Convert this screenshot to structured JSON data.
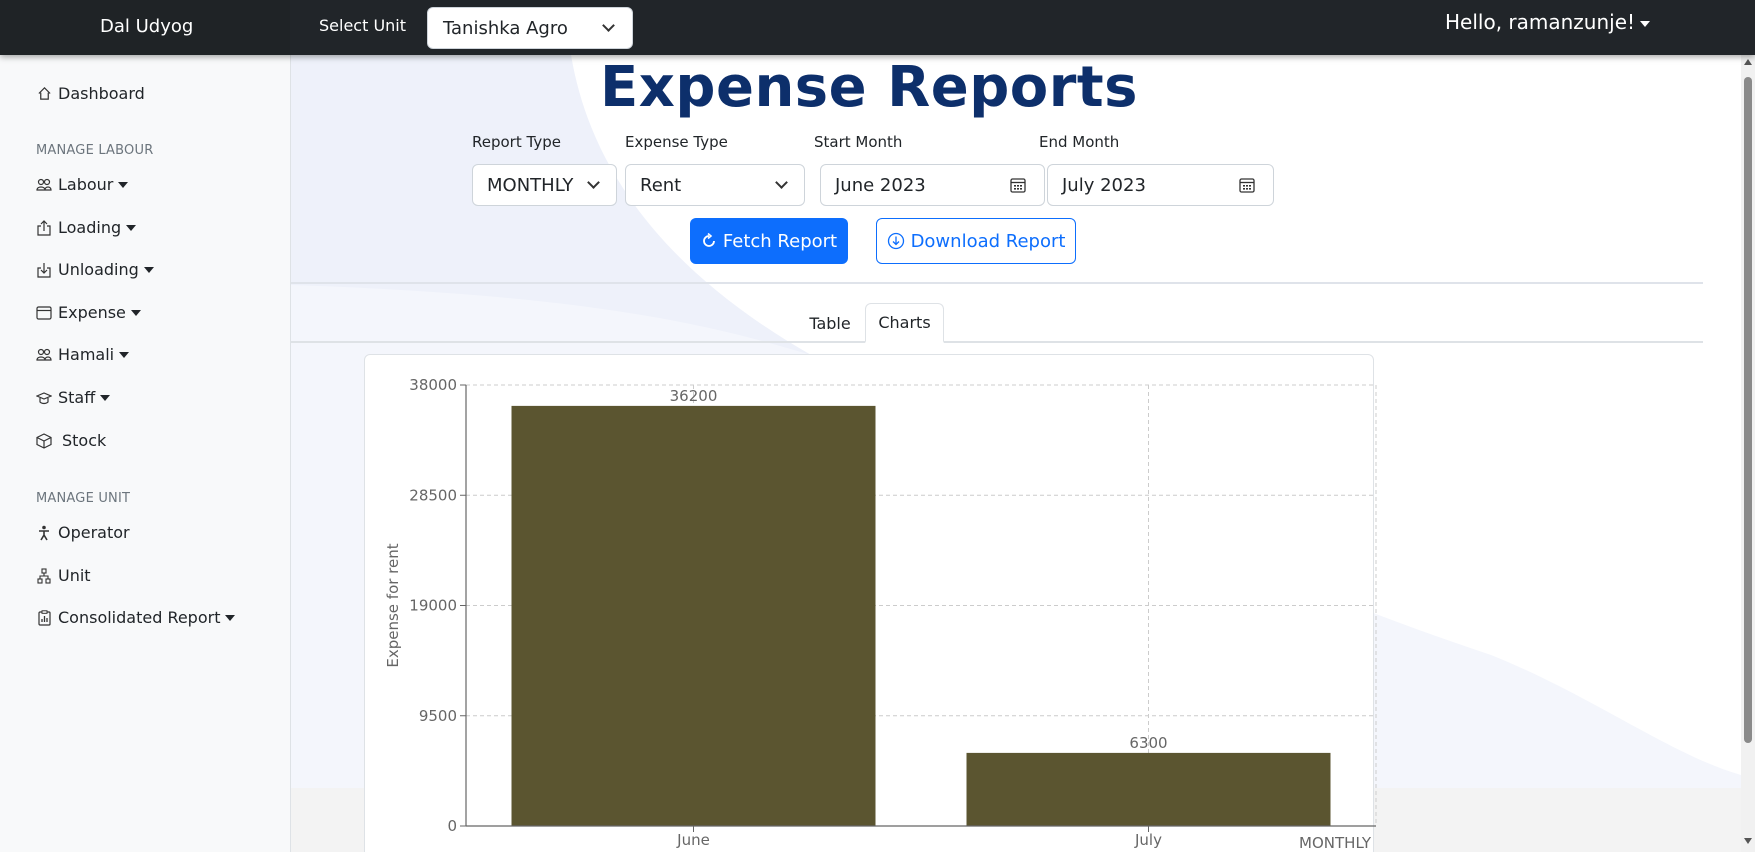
{
  "navbar": {
    "brand": "Dal Udyog",
    "select_unit_label": "Select Unit",
    "selected_unit": "Tanishka Agro",
    "greeting": "Hello, ramanzunje!"
  },
  "sidebar": {
    "dashboard": "Dashboard",
    "section_labour": "MANAGE LABOUR",
    "labour": "Labour",
    "loading": "Loading",
    "unloading": "Unloading",
    "expense": "Expense",
    "hamali": "Hamali",
    "staff": "Staff",
    "stock": "Stock",
    "section_unit": "MANAGE UNIT",
    "operator": "Operator",
    "unit": "Unit",
    "consolidated_report": "Consolidated Report"
  },
  "main": {
    "title": "Expense Reports",
    "filters": {
      "report_type_label": "Report Type",
      "report_type_value": "MONTHLY",
      "expense_type_label": "Expense Type",
      "expense_type_value": "Rent",
      "start_month_label": "Start Month",
      "start_month_value": "June 2023",
      "end_month_label": "End Month",
      "end_month_value": "July 2023"
    },
    "buttons": {
      "fetch": "Fetch Report",
      "download": "Download Report"
    },
    "tabs": [
      {
        "label": "Table",
        "active": false
      },
      {
        "label": "Charts",
        "active": true
      }
    ]
  },
  "colors": {
    "bar": "#5b5530",
    "title": "#0d2f6b",
    "primary": "#0d6efd"
  },
  "chart_data": {
    "type": "bar",
    "categories": [
      "June",
      "July"
    ],
    "values": [
      36200,
      6300
    ],
    "data_labels": [
      "36200",
      "6300"
    ],
    "ylabel": "Expense for rent",
    "xlabel": "MONTHLY",
    "yticks": [
      0,
      9500,
      19000,
      28500,
      38000
    ],
    "ylim": [
      0,
      38000
    ],
    "grid": true
  }
}
